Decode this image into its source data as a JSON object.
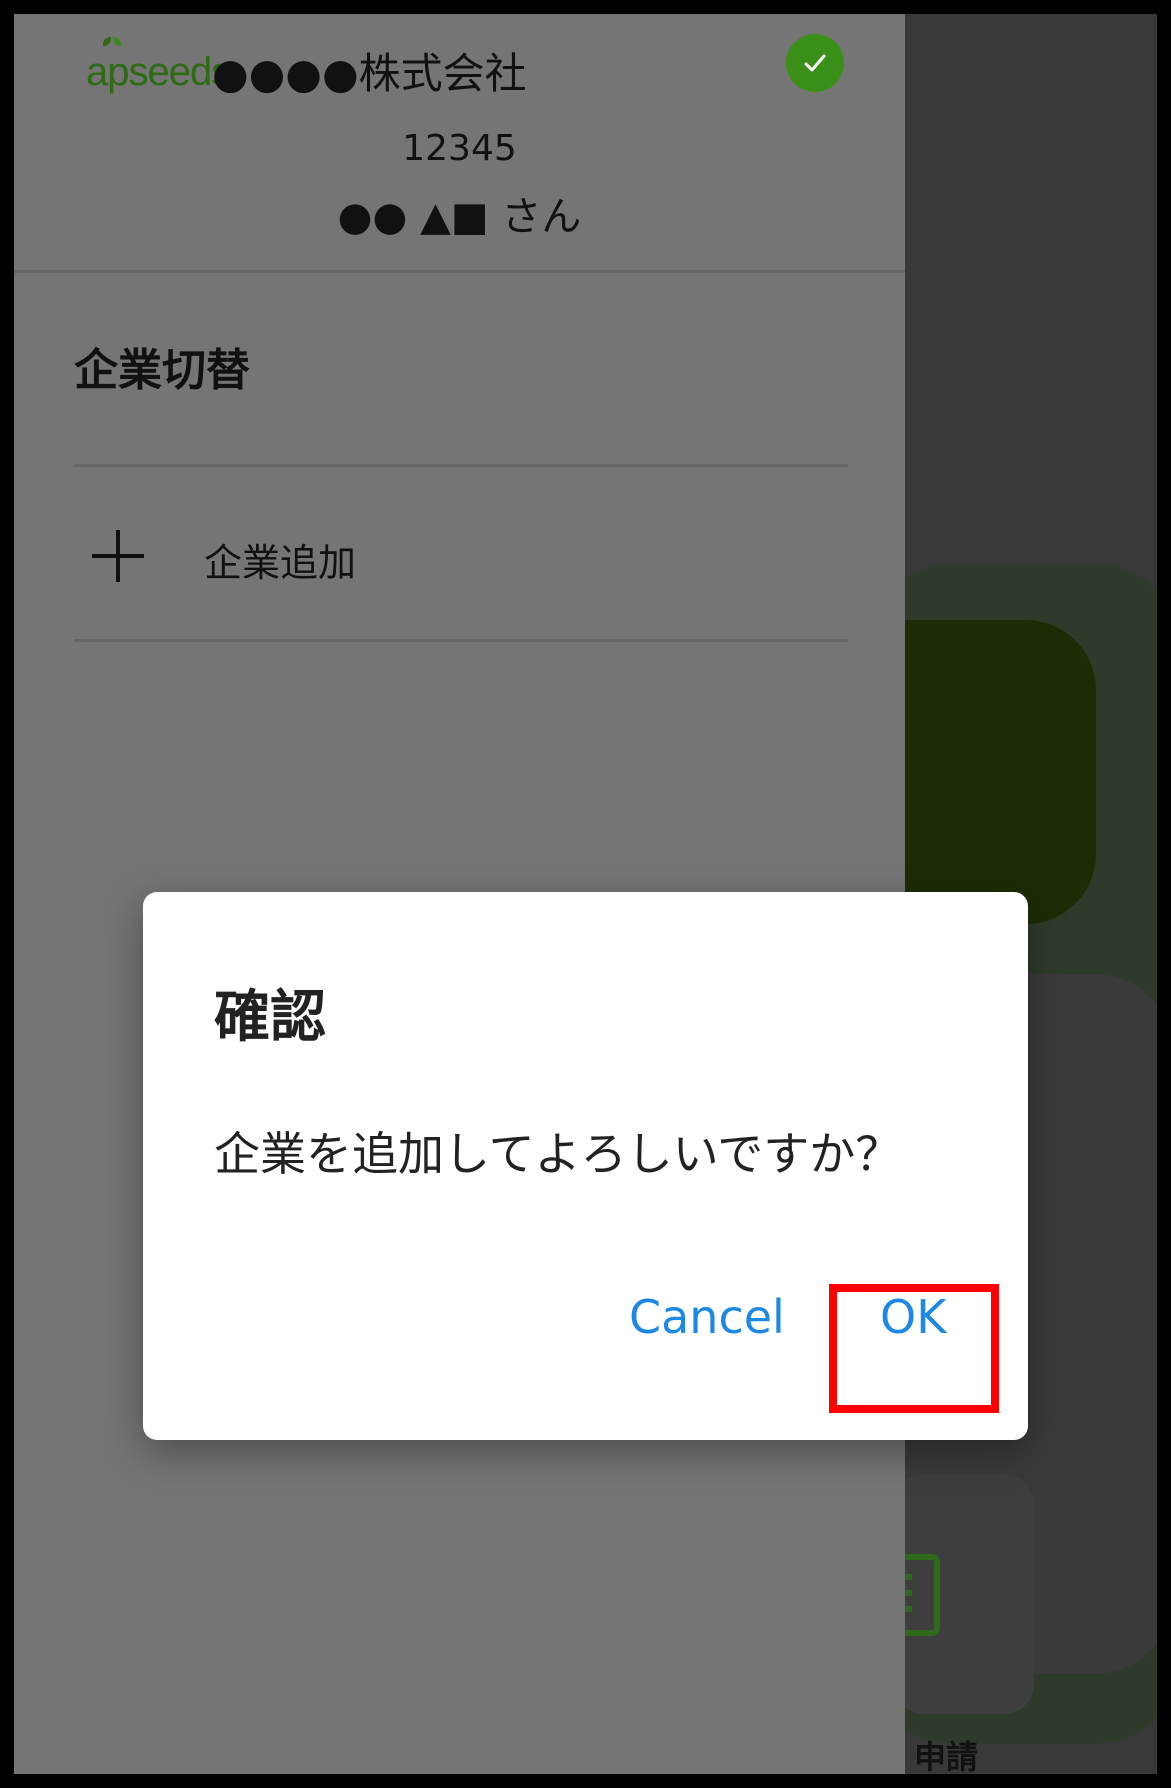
{
  "header": {
    "logo_text": "apseeds",
    "company_name": "●●●●株式会社",
    "user_id": "12345",
    "user_name": "●● ▲■ さん"
  },
  "drawer": {
    "section_title": "企業切替",
    "add_company_label": "企業追加"
  },
  "dialog": {
    "title": "確認",
    "message": "企業を追加してよろしいですか？",
    "cancel_label": "Cancel",
    "ok_label": "OK"
  },
  "background": {
    "partial_label": "申請"
  },
  "colors": {
    "accent_blue": "#1e88e5",
    "brand_green": "#3a8f18",
    "highlight_red": "#ff0000"
  },
  "icons": [
    "check-icon",
    "plus-icon",
    "document-icon"
  ]
}
